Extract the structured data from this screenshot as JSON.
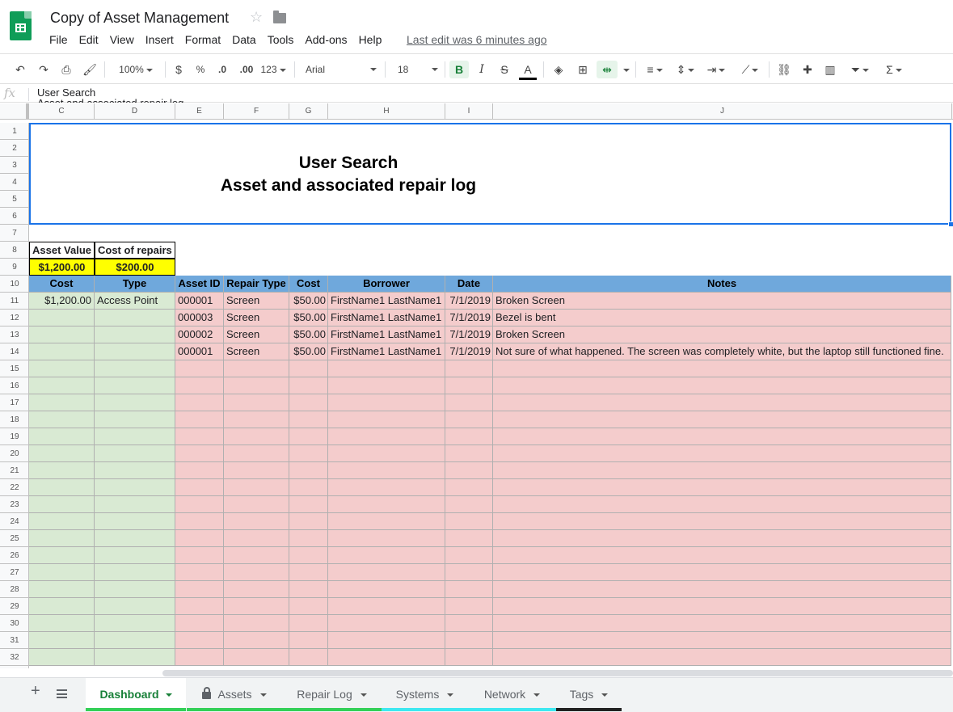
{
  "app": {
    "title": "Copy of Asset Management",
    "last_edit": "Last edit was 6 minutes ago",
    "menu": [
      "File",
      "Edit",
      "View",
      "Insert",
      "Format",
      "Data",
      "Tools",
      "Add-ons",
      "Help"
    ]
  },
  "toolbar": {
    "zoom": "100%",
    "currency": "$",
    "percent": "%",
    "decrease_decimal": ".0",
    "increase_decimal": ".00",
    "more_formats": "123",
    "font": "Arial",
    "font_size": "18",
    "bold": "B",
    "italic": "I",
    "strike": "S",
    "text_color": "A",
    "sum": "Σ"
  },
  "formula_bar": {
    "fx": "fx",
    "line1": "User Search",
    "line2": "Asset and associated repair log"
  },
  "columns": [
    "C",
    "D",
    "E",
    "F",
    "G",
    "H",
    "I",
    "J"
  ],
  "rows": [
    "1",
    "2",
    "3",
    "4",
    "5",
    "6",
    "7",
    "8",
    "9",
    "10",
    "11",
    "12",
    "13",
    "14",
    "15",
    "16",
    "17",
    "18",
    "19",
    "20",
    "21",
    "22",
    "23",
    "24",
    "25",
    "26",
    "27",
    "28",
    "29",
    "30",
    "31",
    "32"
  ],
  "sheet": {
    "title_line1": "User Search",
    "title_line2": "Asset and associated repair log",
    "summary": {
      "asset_value_label": "Asset Value",
      "cost_of_repairs_label": "Cost of repairs",
      "asset_value": "$1,200.00",
      "cost_of_repairs": "$200.00"
    },
    "asset_headers": [
      "Cost",
      "Type"
    ],
    "asset_row": [
      "$1,200.00",
      "Access Point"
    ],
    "repair_headers": [
      "Asset ID",
      "Repair Type",
      "Cost",
      "Borrower",
      "Date",
      "Notes"
    ],
    "repairs": [
      [
        "000001",
        "Screen",
        "$50.00",
        "FirstName1 LastName1",
        "7/1/2019",
        "Broken Screen"
      ],
      [
        "000003",
        "Screen",
        "$50.00",
        "FirstName1 LastName1",
        "7/1/2019",
        "Bezel is bent"
      ],
      [
        "000002",
        "Screen",
        "$50.00",
        "FirstName1 LastName1",
        "7/1/2019",
        "Broken Screen"
      ],
      [
        "000001",
        "Screen",
        "$50.00",
        "FirstName1 LastName1",
        "7/1/2019",
        "Not sure of what happened. The screen was completely white, but the laptop still functioned fine."
      ]
    ]
  },
  "tabs": [
    {
      "label": "Dashboard",
      "color": "#34d058",
      "active": true
    },
    {
      "label": "Assets",
      "color": "#34d058",
      "locked": true
    },
    {
      "label": "Repair Log",
      "color": "#34d058"
    },
    {
      "label": "Systems",
      "color": "#3ee8f0"
    },
    {
      "label": "Network",
      "color": "#3ee8f0"
    },
    {
      "label": "Tags",
      "color": "#222222"
    }
  ]
}
